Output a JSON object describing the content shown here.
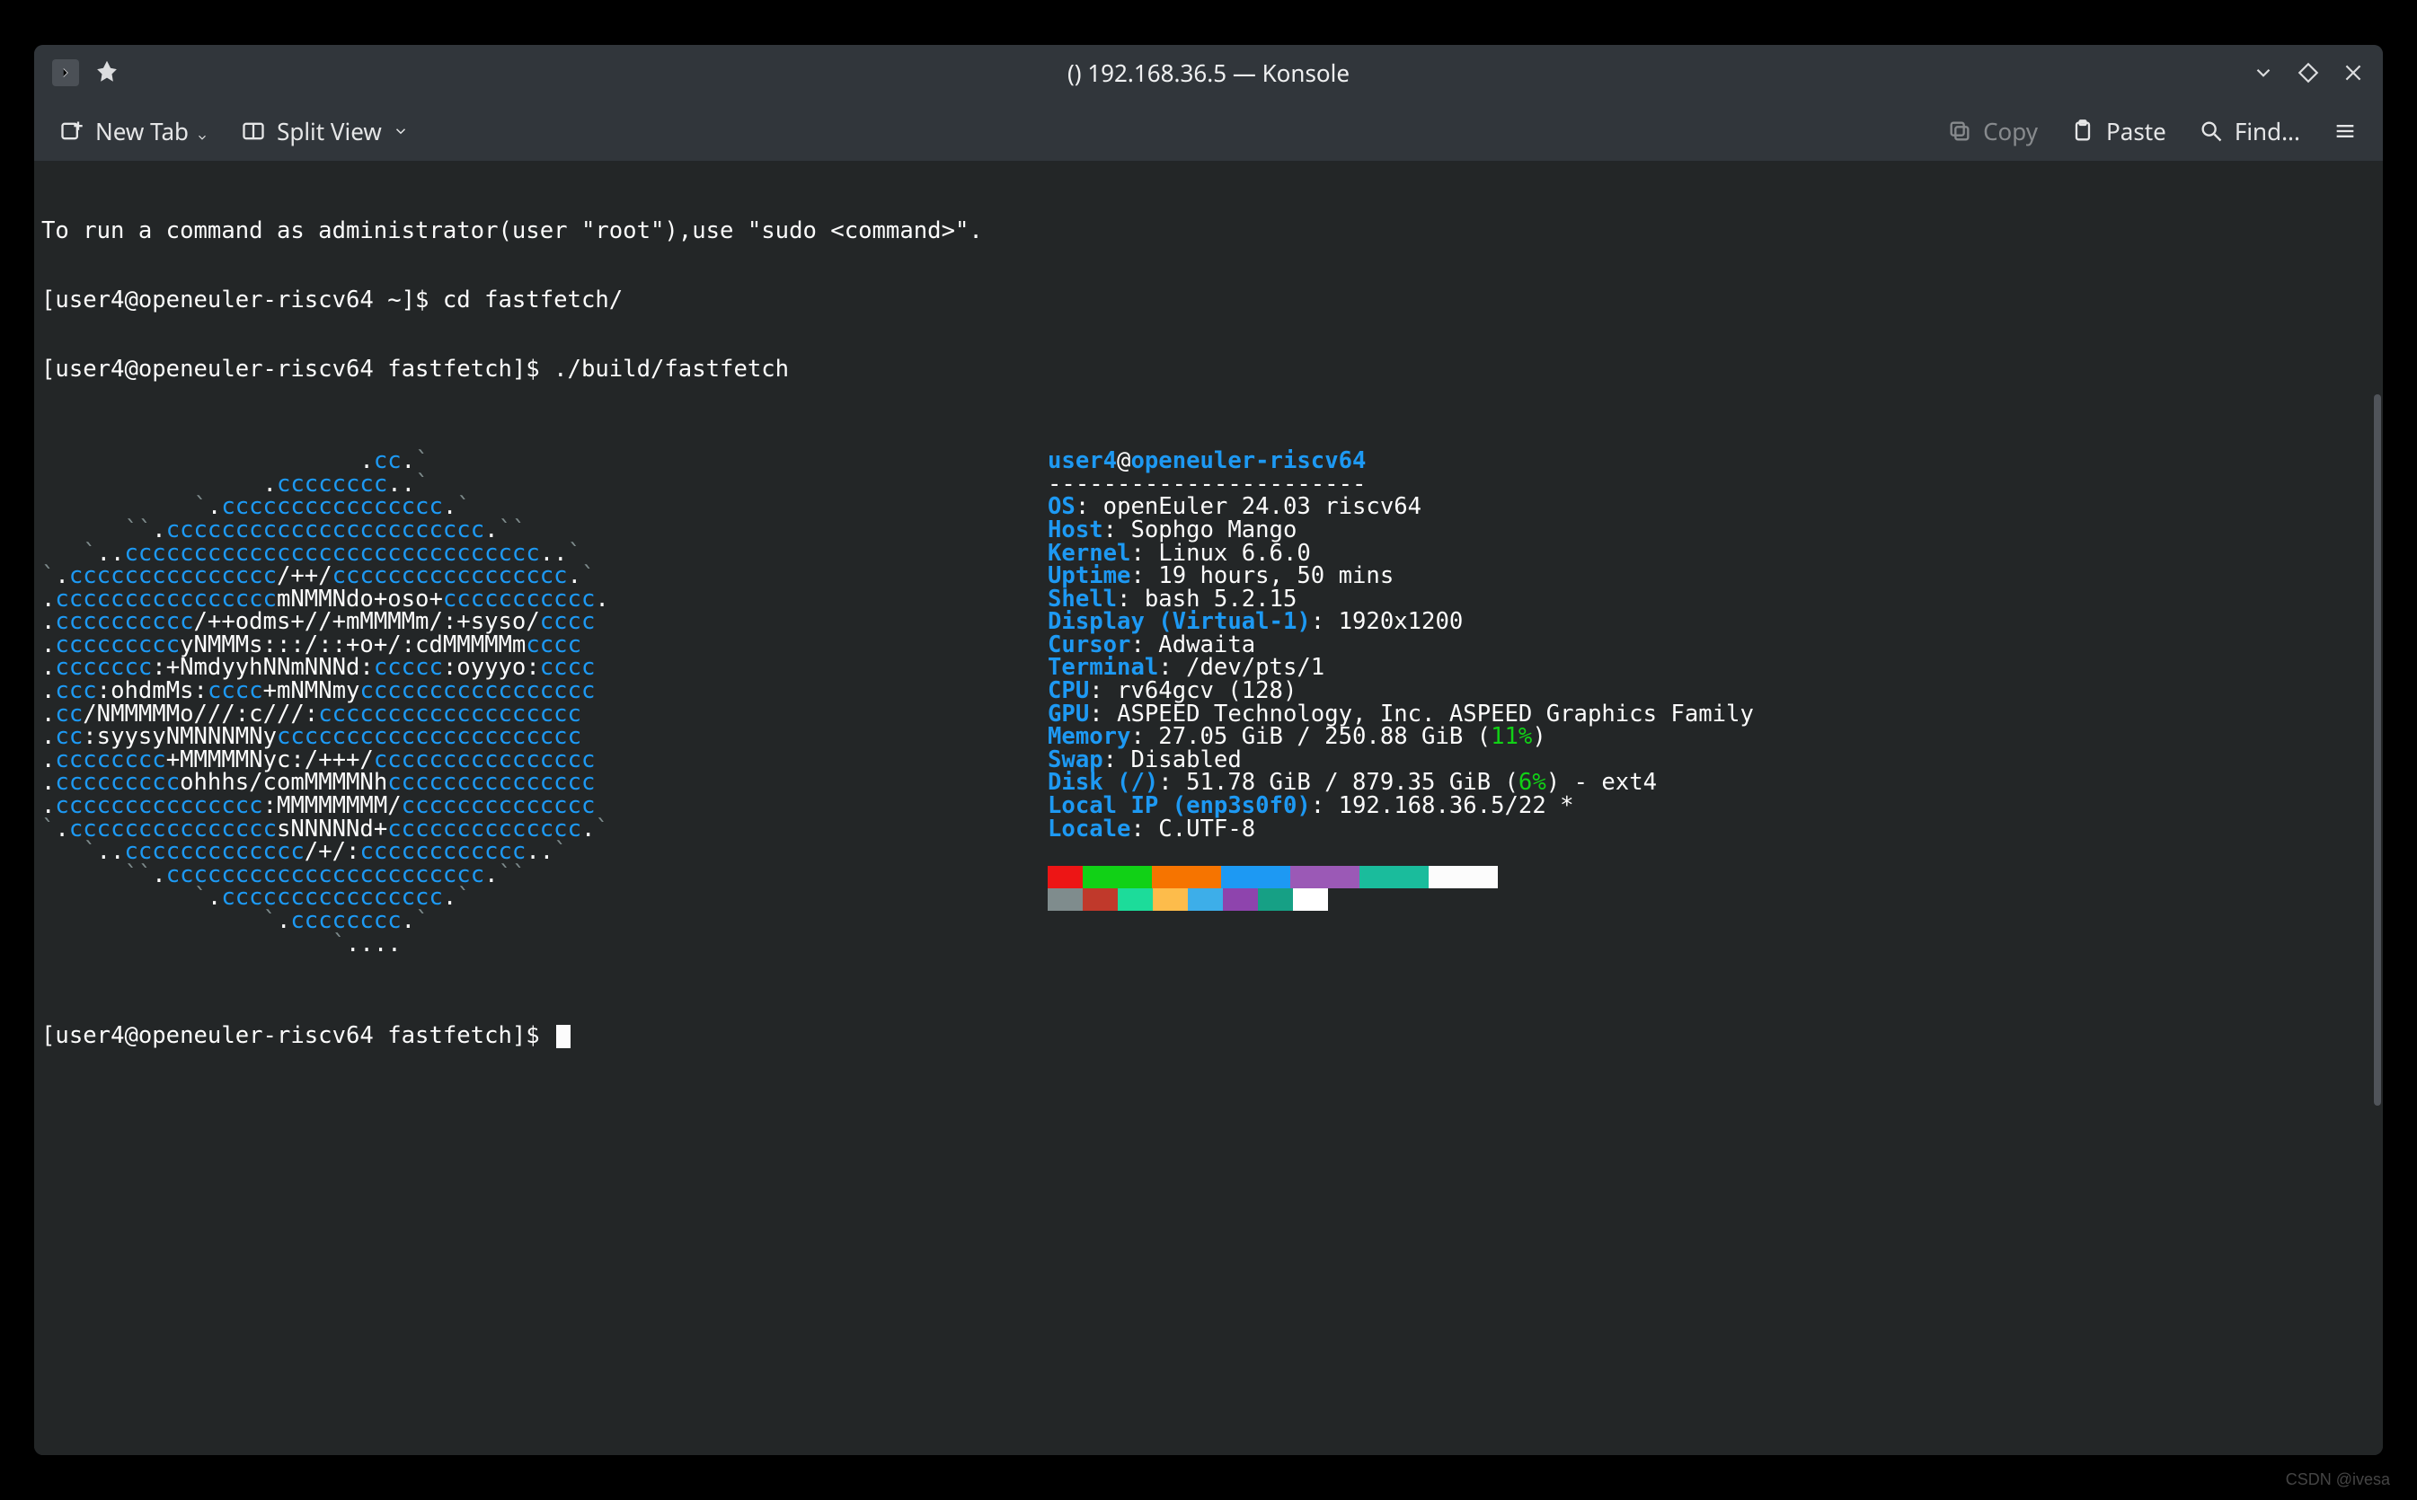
{
  "window": {
    "title": "() 192.168.36.5 — Konsole"
  },
  "toolbar": {
    "new_tab": "New Tab",
    "split_view": "Split View",
    "copy": "Copy",
    "paste": "Paste",
    "find": "Find..."
  },
  "terminal": {
    "line_sudo": "To run a command as administrator(user \"root\"),use \"sudo <command>\".",
    "prompt1_pre": "[user4@openeuler-riscv64 ~]$ ",
    "prompt1_cmd": "cd fastfetch/",
    "prompt2_pre": "[user4@openeuler-riscv64 fastfetch]$ ",
    "prompt2_cmd": "./build/fastfetch",
    "prompt3_pre": "[user4@openeuler-riscv64 fastfetch]$ ",
    "ascii": [
      [
        [
          "                       ",
          "gray"
        ],
        [
          ".",
          "white"
        ],
        [
          "cc",
          "cyan"
        ],
        [
          ".",
          "white"
        ],
        [
          "`",
          "gray"
        ]
      ],
      [
        [
          "                ",
          "gray"
        ],
        [
          ".",
          "white"
        ],
        [
          "cccccccc",
          "cyan"
        ],
        [
          "..",
          "white"
        ],
        [
          "`",
          "gray"
        ]
      ],
      [
        [
          "           `",
          "gray"
        ],
        [
          ".",
          "white"
        ],
        [
          "cccccccccccccccc",
          "cyan"
        ],
        [
          ".",
          "white"
        ],
        [
          "`",
          "gray"
        ]
      ],
      [
        [
          "      ``",
          "gray"
        ],
        [
          ".",
          "white"
        ],
        [
          "ccccccccccccccccccccccc",
          "cyan"
        ],
        [
          ".",
          "white"
        ],
        [
          "``",
          "gray"
        ]
      ],
      [
        [
          "   `",
          "gray"
        ],
        [
          "..",
          "white"
        ],
        [
          "cccccccccccccccccccccccccccccc",
          "cyan"
        ],
        [
          "..",
          "white"
        ],
        [
          "`",
          "gray"
        ]
      ],
      [
        [
          "`",
          "gray"
        ],
        [
          ".",
          "white"
        ],
        [
          "ccccccccccccccc",
          "cyan"
        ],
        [
          "/++/",
          "white"
        ],
        [
          "ccccccccccccccccc",
          "cyan"
        ],
        [
          ".",
          "white"
        ],
        [
          "`",
          "gray"
        ]
      ],
      [
        [
          ".",
          "white"
        ],
        [
          "cccccccccccccccc",
          "cyan"
        ],
        [
          "mNMMNdo+oso+",
          "white"
        ],
        [
          "ccccccccccc",
          "cyan"
        ],
        [
          ".",
          "white"
        ]
      ],
      [
        [
          ".",
          "white"
        ],
        [
          "cccccccccc",
          "cyan"
        ],
        [
          "/++odms+//+mMMMMm/:+syso/",
          "white"
        ],
        [
          "cccc",
          "cyan"
        ]
      ],
      [
        [
          ".",
          "white"
        ],
        [
          "ccccccccc",
          "cyan"
        ],
        [
          "yNMMMs:::/::+o+/:c",
          "white"
        ],
        [
          "dMMMMMm",
          "white"
        ],
        [
          "cccc",
          "cyan"
        ]
      ],
      [
        [
          ".",
          "white"
        ],
        [
          "ccccccc",
          "cyan"
        ],
        [
          ":+NmdyyhNNmNNNd:",
          "white"
        ],
        [
          "ccccc",
          "cyan"
        ],
        [
          ":oyyyo:",
          "white"
        ],
        [
          "cccc",
          "cyan"
        ]
      ],
      [
        [
          ".",
          "white"
        ],
        [
          "ccc",
          "cyan"
        ],
        [
          ":ohdmMs:",
          "white"
        ],
        [
          "cccc",
          "cyan"
        ],
        [
          "+mNMNmy",
          "white"
        ],
        [
          "ccccccccccccccccc",
          "cyan"
        ]
      ],
      [
        [
          ".",
          "white"
        ],
        [
          "cc",
          "cyan"
        ],
        [
          "/NMMMMMo///:c///:",
          "white"
        ],
        [
          "ccccccccccccccccccc",
          "cyan"
        ]
      ],
      [
        [
          ".",
          "white"
        ],
        [
          "cc",
          "cyan"
        ],
        [
          ":syysyNMNNNMNy",
          "white"
        ],
        [
          "cccccccccccccccccccccc",
          "cyan"
        ]
      ],
      [
        [
          ".",
          "white"
        ],
        [
          "cccccccc",
          "cyan"
        ],
        [
          "+MMMMMNyc:/+++/",
          "white"
        ],
        [
          "cccccccccccccccc",
          "cyan"
        ]
      ],
      [
        [
          ".",
          "white"
        ],
        [
          "ccccccccc",
          "cyan"
        ],
        [
          "ohhhs/c",
          "white"
        ],
        [
          "omMMMMNh",
          "white"
        ],
        [
          "ccccccccccccccc",
          "cyan"
        ]
      ],
      [
        [
          ".",
          "white"
        ],
        [
          "ccccccccccccccc",
          "cyan"
        ],
        [
          ":MMMMMMMM/",
          "white"
        ],
        [
          "cccccccccccccc",
          "cyan"
        ]
      ],
      [
        [
          "`",
          "gray"
        ],
        [
          ".",
          "white"
        ],
        [
          "ccccccccccccccc",
          "cyan"
        ],
        [
          "sNNNNNd+",
          "white"
        ],
        [
          "cccccccccccccc",
          "cyan"
        ],
        [
          ".",
          "white"
        ],
        [
          "`",
          "gray"
        ]
      ],
      [
        [
          "   `",
          "gray"
        ],
        [
          "..",
          "white"
        ],
        [
          "ccccccccccccc",
          "cyan"
        ],
        [
          "/+/:",
          "white"
        ],
        [
          "cccccccccccc",
          "cyan"
        ],
        [
          "..",
          "white"
        ],
        [
          "`",
          "gray"
        ]
      ],
      [
        [
          "      ``",
          "gray"
        ],
        [
          ".",
          "white"
        ],
        [
          "ccccccccccccccccccccccc",
          "cyan"
        ],
        [
          ".",
          "white"
        ],
        [
          "``",
          "gray"
        ]
      ],
      [
        [
          "           `",
          "gray"
        ],
        [
          ".",
          "white"
        ],
        [
          "cccccccccccccccc",
          "cyan"
        ],
        [
          ".",
          "white"
        ],
        [
          "`",
          "gray"
        ]
      ],
      [
        [
          "                `",
          "gray"
        ],
        [
          ".",
          "white"
        ],
        [
          "cccccccc",
          "cyan"
        ],
        [
          ".",
          "white"
        ],
        [
          "`",
          "gray"
        ]
      ],
      [
        [
          "                     `",
          "gray"
        ],
        [
          "....",
          "white"
        ]
      ]
    ],
    "header_user": "user4",
    "header_at": "@",
    "header_host": "openeuler-riscv64",
    "header_sep": "-----------------------",
    "info": [
      {
        "k": "OS",
        "v": "openEuler 24.03 riscv64"
      },
      {
        "k": "Host",
        "v": "Sophgo Mango"
      },
      {
        "k": "Kernel",
        "v": "Linux 6.6.0"
      },
      {
        "k": "Uptime",
        "v": "19 hours, 50 mins"
      },
      {
        "k": "Shell",
        "v": "bash 5.2.15"
      },
      {
        "k": "Display (Virtual-1)",
        "v": "1920x1200"
      },
      {
        "k": "Cursor",
        "v": "Adwaita"
      },
      {
        "k": "Terminal",
        "v": "/dev/pts/1"
      },
      {
        "k": "CPU",
        "v": "rv64gcv (128)"
      },
      {
        "k": "GPU",
        "v": "ASPEED Technology, Inc. ASPEED Graphics Family"
      },
      {
        "k": "Memory",
        "v_pre": "27.05 GiB / 250.88 GiB (",
        "v_pct": "11%",
        "v_post": ")"
      },
      {
        "k": "Swap",
        "v": "Disabled"
      },
      {
        "k": "Disk (/)",
        "v_pre": "51.78 GiB / 879.35 GiB (",
        "v_pct": "6%",
        "v_post": ") - ext4"
      },
      {
        "k": "Local IP (enp3s0f0)",
        "v": "192.168.36.5/22 *"
      },
      {
        "k": "Locale",
        "v": "C.UTF-8"
      }
    ],
    "colors_row1": [
      "#ed1515",
      "#11d116",
      "#f67400",
      "#1d99f3",
      "#9b59b6",
      "#1abc9c",
      "#fcfcfc"
    ],
    "colors_row2": [
      "#7f8c8d",
      "#c0392b",
      "#1cdc9a",
      "#fdbc4b",
      "#3daee9",
      "#8e44ad",
      "#16a085",
      "#ffffff"
    ]
  },
  "watermark": "CSDN @ivesa"
}
